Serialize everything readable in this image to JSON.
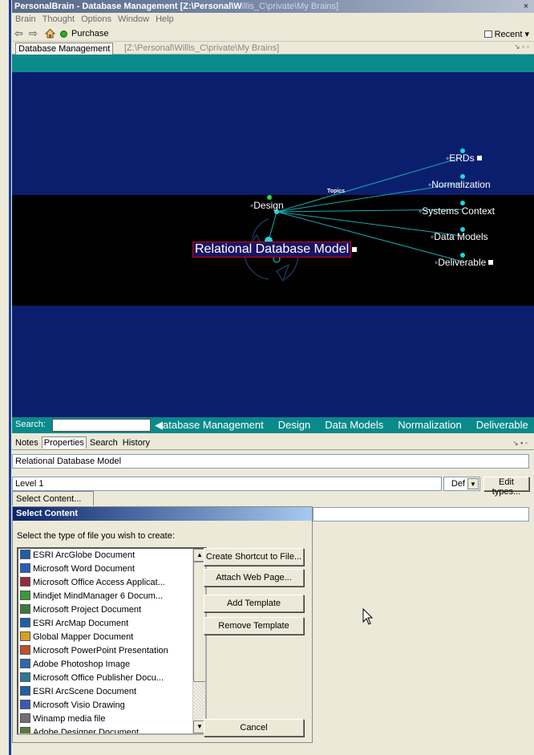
{
  "window": {
    "title": "PersonalBrain - Database Management [Z:\\Personal\\W",
    "title_dim": "illis_C\\private\\My Brains]",
    "close_label": "×"
  },
  "menu": [
    "Brain",
    "Thought",
    "Options",
    "Window",
    "Help"
  ],
  "toolbar": {
    "back_label": "⇦",
    "forward_label": "⇨",
    "purchase_label": "Purchase",
    "recent_label": "Recent ▾"
  },
  "panel": {
    "tab_label": "Database Management",
    "path": "[Z:\\Personal\\Willis_C\\private\\My Brains]",
    "controls": "↘ ▫ ◦"
  },
  "plex": {
    "active_thought": "Relational Database Model",
    "parent": "Design",
    "gate_label": "Topics",
    "children": [
      "ERDs",
      "Normalization",
      "Systems Context",
      "Data Models",
      "Deliverable"
    ]
  },
  "search": {
    "label": "Search:",
    "value": "",
    "history": [
      "◀atabase Management",
      "Design",
      "Data Models",
      "Normalization",
      "Deliverable"
    ]
  },
  "lower_tabs": {
    "items": [
      "Notes",
      "Properties",
      "Search",
      "History"
    ],
    "controls": "↘ ▪ ◦"
  },
  "properties": {
    "name": "Relational Database Model",
    "level": "Level 1",
    "type_value": "Def",
    "edit_types_label": "Edit types...",
    "select_content_label": "Select Content..."
  },
  "dialog": {
    "title": "Select Content",
    "prompt": "Select the type of file you wish to create:",
    "file_types": [
      "ESRI ArcGlobe Document",
      "Microsoft Word Document",
      "Microsoft Office Access Applicat...",
      "Mindjet MindManager 6 Docum...",
      "Microsoft Project Document",
      "ESRI ArcMap Document",
      "Global Mapper Document",
      "Microsoft PowerPoint Presentation",
      "Adobe Photoshop Image",
      "Microsoft Office Publisher Docu...",
      "ESRI ArcScene Document",
      "Microsoft Visio Drawing",
      "Winamp media file",
      "Adobe Designer Document"
    ],
    "file_icon_colors": [
      "#1d5fa8",
      "#2b5fb5",
      "#9b2a3a",
      "#3a9a3a",
      "#3a7a3a",
      "#1d5fa8",
      "#d8a020",
      "#c0502a",
      "#2a6ab0",
      "#2a7a9a",
      "#1d5fa8",
      "#3a5ab5",
      "#707070",
      "#5a7a3a"
    ],
    "buttons": {
      "create_shortcut": "Create Shortcut to File...",
      "attach_web": "Attach Web Page...",
      "add_template": "Add Template",
      "remove_template": "Remove Template",
      "cancel": "Cancel"
    }
  }
}
